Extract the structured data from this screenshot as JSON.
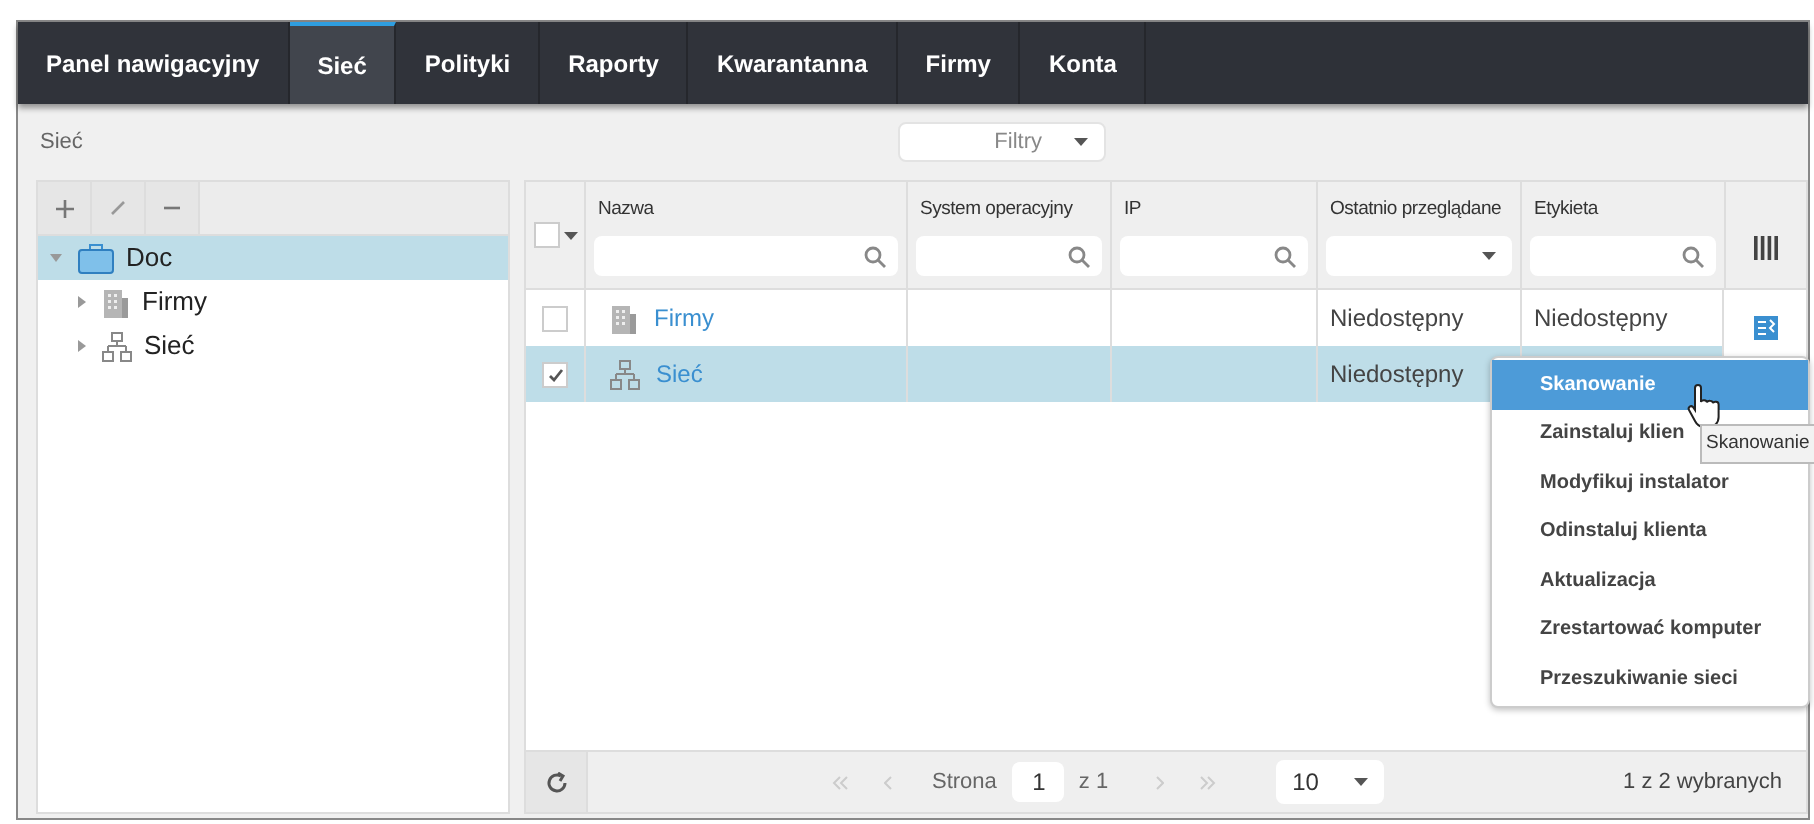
{
  "tabs": [
    {
      "label": "Panel nawigacyjny",
      "selected": false
    },
    {
      "label": "Sieć",
      "selected": true
    },
    {
      "label": "Polityki",
      "selected": false
    },
    {
      "label": "Raporty",
      "selected": false
    },
    {
      "label": "Kwarantanna",
      "selected": false
    },
    {
      "label": "Firmy",
      "selected": false
    },
    {
      "label": "Konta",
      "selected": false
    }
  ],
  "breadcrumb": "Sieć",
  "filter_dropdown": {
    "label": "Filtry"
  },
  "tree": [
    {
      "label": "Doc",
      "kind": "folder",
      "selected": true,
      "expanded": true,
      "children": [
        {
          "label": "Firmy",
          "kind": "building",
          "selected": false,
          "expanded": false
        },
        {
          "label": "Sieć",
          "kind": "network",
          "selected": false,
          "expanded": false
        }
      ]
    }
  ],
  "table": {
    "select_all_checked": false,
    "columns": [
      {
        "label": "Nazwa",
        "kind": "search"
      },
      {
        "label": "System operacyjny",
        "kind": "search"
      },
      {
        "label": "IP",
        "kind": "search"
      },
      {
        "label": "Ostatnio przeglądane",
        "kind": "select"
      },
      {
        "label": "Etykieta",
        "kind": "search"
      }
    ],
    "rows": [
      {
        "kind": "building",
        "checked": false,
        "selected": false,
        "cells": [
          "Firmy",
          "",
          "",
          "Niedostępny",
          "Niedostępny"
        ]
      },
      {
        "kind": "network",
        "checked": true,
        "selected": true,
        "cells": [
          "Sieć",
          "",
          "",
          "Niedostępny",
          ""
        ]
      }
    ]
  },
  "context_menu": [
    {
      "label": "Skanowanie",
      "selected": true
    },
    {
      "label": "Zainstaluj klien",
      "selected": false
    },
    {
      "label": "Modyfikuj instalator",
      "selected": false
    },
    {
      "label": "Odinstaluj klienta",
      "selected": false
    },
    {
      "label": "Aktualizacja",
      "selected": false
    },
    {
      "label": "Zrestartować komputer",
      "selected": false
    },
    {
      "label": "Przeszukiwanie sieci",
      "selected": false
    }
  ],
  "tooltip": "Skanowanie",
  "pagination": {
    "page_label": "Strona",
    "page": "1",
    "of": "z 1",
    "page_size": "10",
    "selection": "1 z 2 wybranych"
  }
}
